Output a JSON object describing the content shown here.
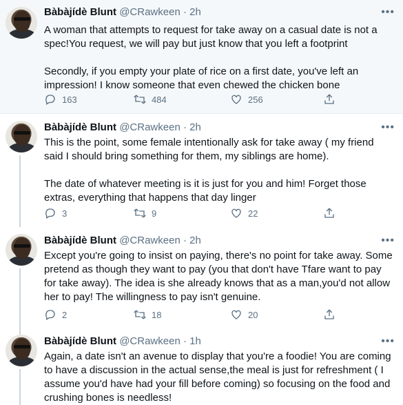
{
  "tweets": [
    {
      "name": "Bàbàjídè Blunt",
      "handle": "@CRawkeen",
      "dot": "·",
      "time": "2h",
      "text": "A woman that attempts to request for take away on a casual date is not a spec!You request, we will pay but just know that you left a footprint\n\nSecondly, if you empty your plate of rice on a first date, you've left an impression! I know someone that even chewed the chicken bone",
      "replies": "163",
      "retweets": "484",
      "likes": "256"
    },
    {
      "name": "Bàbàjídè Blunt",
      "handle": "@CRawkeen",
      "dot": "·",
      "time": "2h",
      "text": "This is the point, some female intentionally ask for take away ( my friend said I should bring something for them, my siblings are home).\n\nThe date of whatever meeting is it is just for you and him! Forget those extras, everything that happens that day linger",
      "replies": "3",
      "retweets": "9",
      "likes": "22"
    },
    {
      "name": "Bàbàjídè Blunt",
      "handle": "@CRawkeen",
      "dot": "·",
      "time": "2h",
      "text": "Except you're going to insist on paying, there's no point for take away. Some pretend as though they want to pay (you that don't have Tfare want to pay for take away). The idea is she already knows that as a man,you'd not allow her to pay! The willingness to pay isn't genuine.",
      "replies": "2",
      "retweets": "18",
      "likes": "20"
    },
    {
      "name": "Bàbàjídè Blunt",
      "handle": "@CRawkeen",
      "dot": "·",
      "time": "1h",
      "text": "Again, a date isn't an avenue to display that you're a foodie! You are coming to have a discussion in the actual sense,the meal is just for refreshment ( I assume you'd have had your fill before coming) so focusing on the food and crushing bones is needless!"
    }
  ],
  "more_glyph": "•••"
}
